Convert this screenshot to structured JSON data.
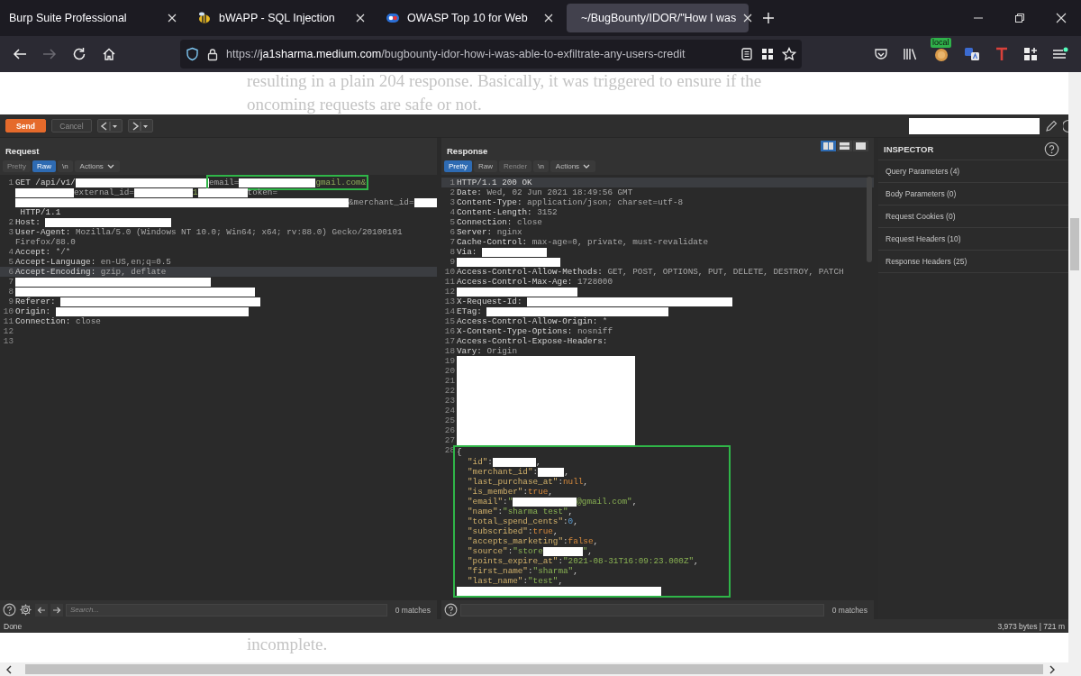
{
  "browser": {
    "tabs": [
      {
        "title": "Burp Suite Professional",
        "selected": false
      },
      {
        "title": "bWAPP - SQL Injection",
        "selected": false
      },
      {
        "title": "OWASP Top 10 for Web",
        "selected": false
      },
      {
        "title": "~/BugBounty/IDOR/\"How I was",
        "selected": true
      }
    ],
    "forward_disabled": true,
    "address": {
      "scheme": "https://",
      "host": "ja1sharma.medium.com",
      "path": "/bugbounty-idor-how-i-was-able-to-exfiltrate-any-users-credit"
    },
    "extension_badge": "local"
  },
  "article": {
    "top_lines": [
      "resulting in a plain 204 response. Basically, it was triggered to ensure if the",
      "oncoming requests are safe or not."
    ],
    "bottom_lines": [
      "incomplete."
    ]
  },
  "burp": {
    "toolbar": {
      "buttons": [
        {
          "label": "Send",
          "disabled": false
        },
        {
          "label": "Cancel",
          "disabled": true
        }
      ]
    },
    "request": {
      "title": "Request",
      "view_tabs": [
        {
          "label": "Pretty",
          "kind": "tab",
          "selected": false,
          "disabled": true
        },
        {
          "label": "Raw",
          "kind": "tab",
          "selected": true,
          "disabled": false
        },
        {
          "label": "\\n",
          "kind": "tab",
          "selected": false,
          "disabled": false
        },
        {
          "label": "Actions",
          "kind": "menu",
          "disabled": false
        }
      ],
      "lines": [
        {
          "number": "1",
          "highlighted": false,
          "segments": [
            {
              "kind": "name",
              "text": "GET /api/v1/"
            },
            {
              "kind": "redacted"
            },
            {
              "kind": "box",
              "segments": [
                {
                  "kind": "value",
                  "text": "email="
                },
                {
                  "kind": "redacted"
                },
                {
                  "kind": "param",
                  "text": "gmail.com&"
                }
              ]
            }
          ]
        },
        {
          "highlighted": false,
          "segments": [
            {
              "kind": "redacted"
            },
            {
              "kind": "value",
              "text": "external_id="
            },
            {
              "kind": "redacted"
            },
            {
              "kind": "param",
              "text": "1"
            },
            {
              "kind": "redacted"
            },
            {
              "kind": "value",
              "text": "token="
            }
          ]
        },
        {
          "highlighted": false,
          "segments": [
            {
              "kind": "redacted"
            },
            {
              "kind": "value",
              "text": "&merchant_id="
            },
            {
              "kind": "redacted"
            }
          ]
        },
        {
          "highlighted": false,
          "segments": [
            {
              "kind": "name",
              "text": " HTTP/1.1"
            }
          ]
        },
        {
          "number": "2",
          "highlighted": false,
          "segments": [
            {
              "kind": "name",
              "text": "Host: "
            },
            {
              "kind": "redacted"
            }
          ]
        },
        {
          "number": "3",
          "highlighted": false,
          "segments": [
            {
              "kind": "name",
              "text": "User-Agent:"
            },
            {
              "kind": "value",
              "text": " Mozilla/5.0 (Windows NT 10.0; Win64; x64; rv:88.0) Gecko/20100101"
            }
          ]
        },
        {
          "highlighted": false,
          "segments": [
            {
              "kind": "value",
              "text": "Firefox/88.0"
            }
          ]
        },
        {
          "number": "4",
          "highlighted": false,
          "segments": [
            {
              "kind": "name",
              "text": "Accept:"
            },
            {
              "kind": "value",
              "text": " */*"
            }
          ]
        },
        {
          "number": "5",
          "highlighted": false,
          "segments": [
            {
              "kind": "name",
              "text": "Accept-Language:"
            },
            {
              "kind": "value",
              "text": " en-US,en;q=0.5"
            }
          ]
        },
        {
          "number": "6",
          "highlighted": true,
          "segments": [
            {
              "kind": "name",
              "text": "Accept-Encoding:"
            },
            {
              "kind": "value",
              "text": " gzip, deflate"
            }
          ]
        },
        {
          "number": "7",
          "highlighted": false,
          "segments": [
            {
              "kind": "redacted"
            }
          ]
        },
        {
          "number": "8",
          "highlighted": false,
          "segments": [
            {
              "kind": "redacted"
            }
          ]
        },
        {
          "number": "9",
          "highlighted": false,
          "segments": [
            {
              "kind": "name",
              "text": "Referer: "
            },
            {
              "kind": "redacted"
            }
          ]
        },
        {
          "number": "10",
          "highlighted": false,
          "segments": [
            {
              "kind": "name",
              "text": "Origin: "
            },
            {
              "kind": "redacted"
            }
          ]
        },
        {
          "number": "11",
          "highlighted": false,
          "segments": [
            {
              "kind": "name",
              "text": "Connection:"
            },
            {
              "kind": "value",
              "text": " close"
            }
          ]
        },
        {
          "number": "12",
          "highlighted": false
        },
        {
          "number": "13",
          "highlighted": false
        }
      ],
      "search": {
        "placeholder": "Search...",
        "matches": "0 matches"
      }
    },
    "response": {
      "title": "Response",
      "layouts": [
        {
          "selected": true
        },
        {
          "selected": false
        },
        {
          "selected": false
        }
      ],
      "view_tabs": [
        {
          "label": "Pretty",
          "kind": "tab",
          "selected": true,
          "disabled": false
        },
        {
          "label": "Raw",
          "kind": "tab",
          "selected": false,
          "disabled": false
        },
        {
          "label": "Render",
          "kind": "tab",
          "selected": false,
          "disabled": true
        },
        {
          "label": "\\n",
          "kind": "tab",
          "selected": false,
          "disabled": false
        },
        {
          "label": "Actions",
          "kind": "menu",
          "disabled": false
        }
      ],
      "lines": [
        {
          "number": "1",
          "highlighted": true,
          "segments": [
            {
              "kind": "name",
              "text": "HTTP/1.1 200 OK"
            }
          ]
        },
        {
          "number": "2",
          "highlighted": false,
          "segments": [
            {
              "kind": "name",
              "text": "Date:"
            },
            {
              "kind": "value",
              "text": " Wed, 02 Jun 2021 18:49:56 GMT"
            }
          ]
        },
        {
          "number": "3",
          "highlighted": false,
          "segments": [
            {
              "kind": "name",
              "text": "Content-Type:"
            },
            {
              "kind": "value",
              "text": " application/json; charset=utf-8"
            }
          ]
        },
        {
          "number": "4",
          "highlighted": false,
          "segments": [
            {
              "kind": "name",
              "text": "Content-Length:"
            },
            {
              "kind": "value",
              "text": " 3152"
            }
          ]
        },
        {
          "number": "5",
          "highlighted": false,
          "segments": [
            {
              "kind": "name",
              "text": "Connection:"
            },
            {
              "kind": "value",
              "text": " close"
            }
          ]
        },
        {
          "number": "6",
          "highlighted": false,
          "segments": [
            {
              "kind": "name",
              "text": "Server:"
            },
            {
              "kind": "value",
              "text": " nginx"
            }
          ]
        },
        {
          "number": "7",
          "highlighted": false,
          "segments": [
            {
              "kind": "name",
              "text": "Cache-Control:"
            },
            {
              "kind": "value",
              "text": " max-age=0, private, must-revalidate"
            }
          ]
        },
        {
          "number": "8",
          "highlighted": false,
          "segments": [
            {
              "kind": "name",
              "text": "Via: "
            },
            {
              "kind": "redacted"
            }
          ]
        },
        {
          "number": "9",
          "highlighted": false,
          "segments": [
            {
              "kind": "redacted"
            }
          ]
        },
        {
          "number": "10",
          "highlighted": false,
          "segments": [
            {
              "kind": "name",
              "text": "Access-Control-Allow-Methods:"
            },
            {
              "kind": "value",
              "text": " GET, POST, OPTIONS, PUT, DELETE, DESTROY, PATCH"
            }
          ]
        },
        {
          "number": "11",
          "highlighted": false,
          "segments": [
            {
              "kind": "name",
              "text": "Access-Control-Max-Age:"
            },
            {
              "kind": "value",
              "text": " 1728000"
            }
          ]
        },
        {
          "number": "12",
          "highlighted": false,
          "segments": [
            {
              "kind": "redacted"
            }
          ]
        },
        {
          "number": "13",
          "highlighted": false,
          "segments": [
            {
              "kind": "name",
              "text": "X-Request-Id: "
            },
            {
              "kind": "redacted"
            }
          ]
        },
        {
          "number": "14",
          "highlighted": false,
          "segments": [
            {
              "kind": "name",
              "text": "ETag: "
            },
            {
              "kind": "redacted"
            }
          ]
        },
        {
          "number": "15",
          "highlighted": false,
          "segments": [
            {
              "kind": "name",
              "text": "Access-Control-Allow-Origin:"
            },
            {
              "kind": "value",
              "text": " *"
            }
          ]
        },
        {
          "number": "16",
          "highlighted": false,
          "segments": [
            {
              "kind": "name",
              "text": "X-Content-Type-Options:"
            },
            {
              "kind": "value",
              "text": " nosniff"
            }
          ]
        },
        {
          "number": "17",
          "highlighted": false,
          "segments": [
            {
              "kind": "name",
              "text": "Access-Control-Expose-Headers:"
            }
          ]
        },
        {
          "number": "18",
          "highlighted": false,
          "segments": [
            {
              "kind": "name",
              "text": "Vary:"
            },
            {
              "kind": "value",
              "text": " Origin"
            }
          ]
        },
        {
          "number": "19",
          "highlighted": false,
          "segments": [
            {
              "kind": "redacted"
            }
          ]
        },
        {
          "number": "20",
          "highlighted": false,
          "segments": [
            {
              "kind": "redacted"
            }
          ]
        },
        {
          "number": "21",
          "highlighted": false,
          "segments": [
            {
              "kind": "redacted"
            }
          ]
        },
        {
          "number": "22",
          "highlighted": false,
          "segments": [
            {
              "kind": "redacted"
            }
          ]
        },
        {
          "number": "23",
          "highlighted": false,
          "segments": [
            {
              "kind": "redacted"
            }
          ]
        },
        {
          "number": "24",
          "highlighted": false,
          "segments": [
            {
              "kind": "redacted"
            }
          ]
        },
        {
          "number": "25",
          "highlighted": false,
          "segments": [
            {
              "kind": "redacted"
            }
          ]
        },
        {
          "number": "26",
          "highlighted": false,
          "segments": [
            {
              "kind": "redacted"
            }
          ]
        },
        {
          "number": "27",
          "highlighted": false,
          "segments": [
            {
              "kind": "redacted"
            }
          ]
        }
      ],
      "body": {
        "number": "28",
        "rows": [
          {
            "indented": false,
            "segments": [
              {
                "kind": "punct",
                "text": "{"
              }
            ]
          },
          {
            "indented": true,
            "segments": [
              {
                "kind": "key",
                "text": "\"id\""
              },
              {
                "kind": "punct",
                "text": ":"
              },
              {
                "kind": "redacted"
              },
              {
                "kind": "punct",
                "text": ","
              }
            ]
          },
          {
            "indented": true,
            "segments": [
              {
                "kind": "key",
                "text": "\"merchant_id\""
              },
              {
                "kind": "punct",
                "text": ":"
              },
              {
                "kind": "redacted"
              },
              {
                "kind": "punct",
                "text": ","
              }
            ]
          },
          {
            "indented": true,
            "segments": [
              {
                "kind": "key",
                "text": "\"last_purchase_at\""
              },
              {
                "kind": "punct",
                "text": ":"
              },
              {
                "kind": "literal",
                "text": "null"
              },
              {
                "kind": "punct",
                "text": ","
              }
            ]
          },
          {
            "indented": true,
            "segments": [
              {
                "kind": "key",
                "text": "\"is_member\""
              },
              {
                "kind": "punct",
                "text": ":"
              },
              {
                "kind": "literal",
                "text": "true"
              },
              {
                "kind": "punct",
                "text": ","
              }
            ]
          },
          {
            "indented": true,
            "segments": [
              {
                "kind": "key",
                "text": "\"email\""
              },
              {
                "kind": "punct",
                "text": ":"
              },
              {
                "kind": "string",
                "text": "\""
              },
              {
                "kind": "redacted"
              },
              {
                "kind": "string",
                "text": "@gmail.com\""
              },
              {
                "kind": "punct",
                "text": ","
              }
            ]
          },
          {
            "indented": true,
            "segments": [
              {
                "kind": "key",
                "text": "\"name\""
              },
              {
                "kind": "punct",
                "text": ":"
              },
              {
                "kind": "string",
                "text": "\"sharma test\""
              },
              {
                "kind": "punct",
                "text": ","
              }
            ]
          },
          {
            "indented": true,
            "segments": [
              {
                "kind": "key",
                "text": "\"total_spend_cents\""
              },
              {
                "kind": "punct",
                "text": ":"
              },
              {
                "kind": "number",
                "text": "0"
              },
              {
                "kind": "punct",
                "text": ","
              }
            ]
          },
          {
            "indented": true,
            "segments": [
              {
                "kind": "key",
                "text": "\"subscribed\""
              },
              {
                "kind": "punct",
                "text": ":"
              },
              {
                "kind": "literal",
                "text": "true"
              },
              {
                "kind": "punct",
                "text": ","
              }
            ]
          },
          {
            "indented": true,
            "segments": [
              {
                "kind": "key",
                "text": "\"accepts_marketing\""
              },
              {
                "kind": "punct",
                "text": ":"
              },
              {
                "kind": "literal",
                "text": "false"
              },
              {
                "kind": "punct",
                "text": ","
              }
            ]
          },
          {
            "indented": true,
            "segments": [
              {
                "kind": "key",
                "text": "\"source\""
              },
              {
                "kind": "punct",
                "text": ":"
              },
              {
                "kind": "string",
                "text": "\"store"
              },
              {
                "kind": "redacted"
              },
              {
                "kind": "string",
                "text": "\""
              },
              {
                "kind": "punct",
                "text": ","
              }
            ]
          },
          {
            "indented": true,
            "segments": [
              {
                "kind": "key",
                "text": "\"points_expire_at\""
              },
              {
                "kind": "punct",
                "text": ":"
              },
              {
                "kind": "string",
                "text": "\"2021-08-31T16:09:23.000Z\""
              },
              {
                "kind": "punct",
                "text": ","
              }
            ]
          },
          {
            "indented": true,
            "segments": [
              {
                "kind": "key",
                "text": "\"first_name\""
              },
              {
                "kind": "punct",
                "text": ":"
              },
              {
                "kind": "string",
                "text": "\"sharma\""
              },
              {
                "kind": "punct",
                "text": ","
              }
            ]
          },
          {
            "indented": true,
            "segments": [
              {
                "kind": "key",
                "text": "\"last_name\""
              },
              {
                "kind": "punct",
                "text": ":"
              },
              {
                "kind": "string",
                "text": "\"test\""
              },
              {
                "kind": "punct",
                "text": ","
              }
            ]
          },
          {
            "indented": false,
            "segments": [
              {
                "kind": "redacted"
              }
            ]
          }
        ]
      },
      "search": {
        "matches": "0 matches"
      }
    },
    "inspector": {
      "title": "INSPECTOR",
      "sections": [
        "Query Parameters (4)",
        "Body Parameters (0)",
        "Request Cookies (0)",
        "Request Headers (10)",
        "Response Headers (25)"
      ]
    },
    "status": {
      "left": "Done",
      "right": "3,973 bytes | 721 m"
    }
  }
}
